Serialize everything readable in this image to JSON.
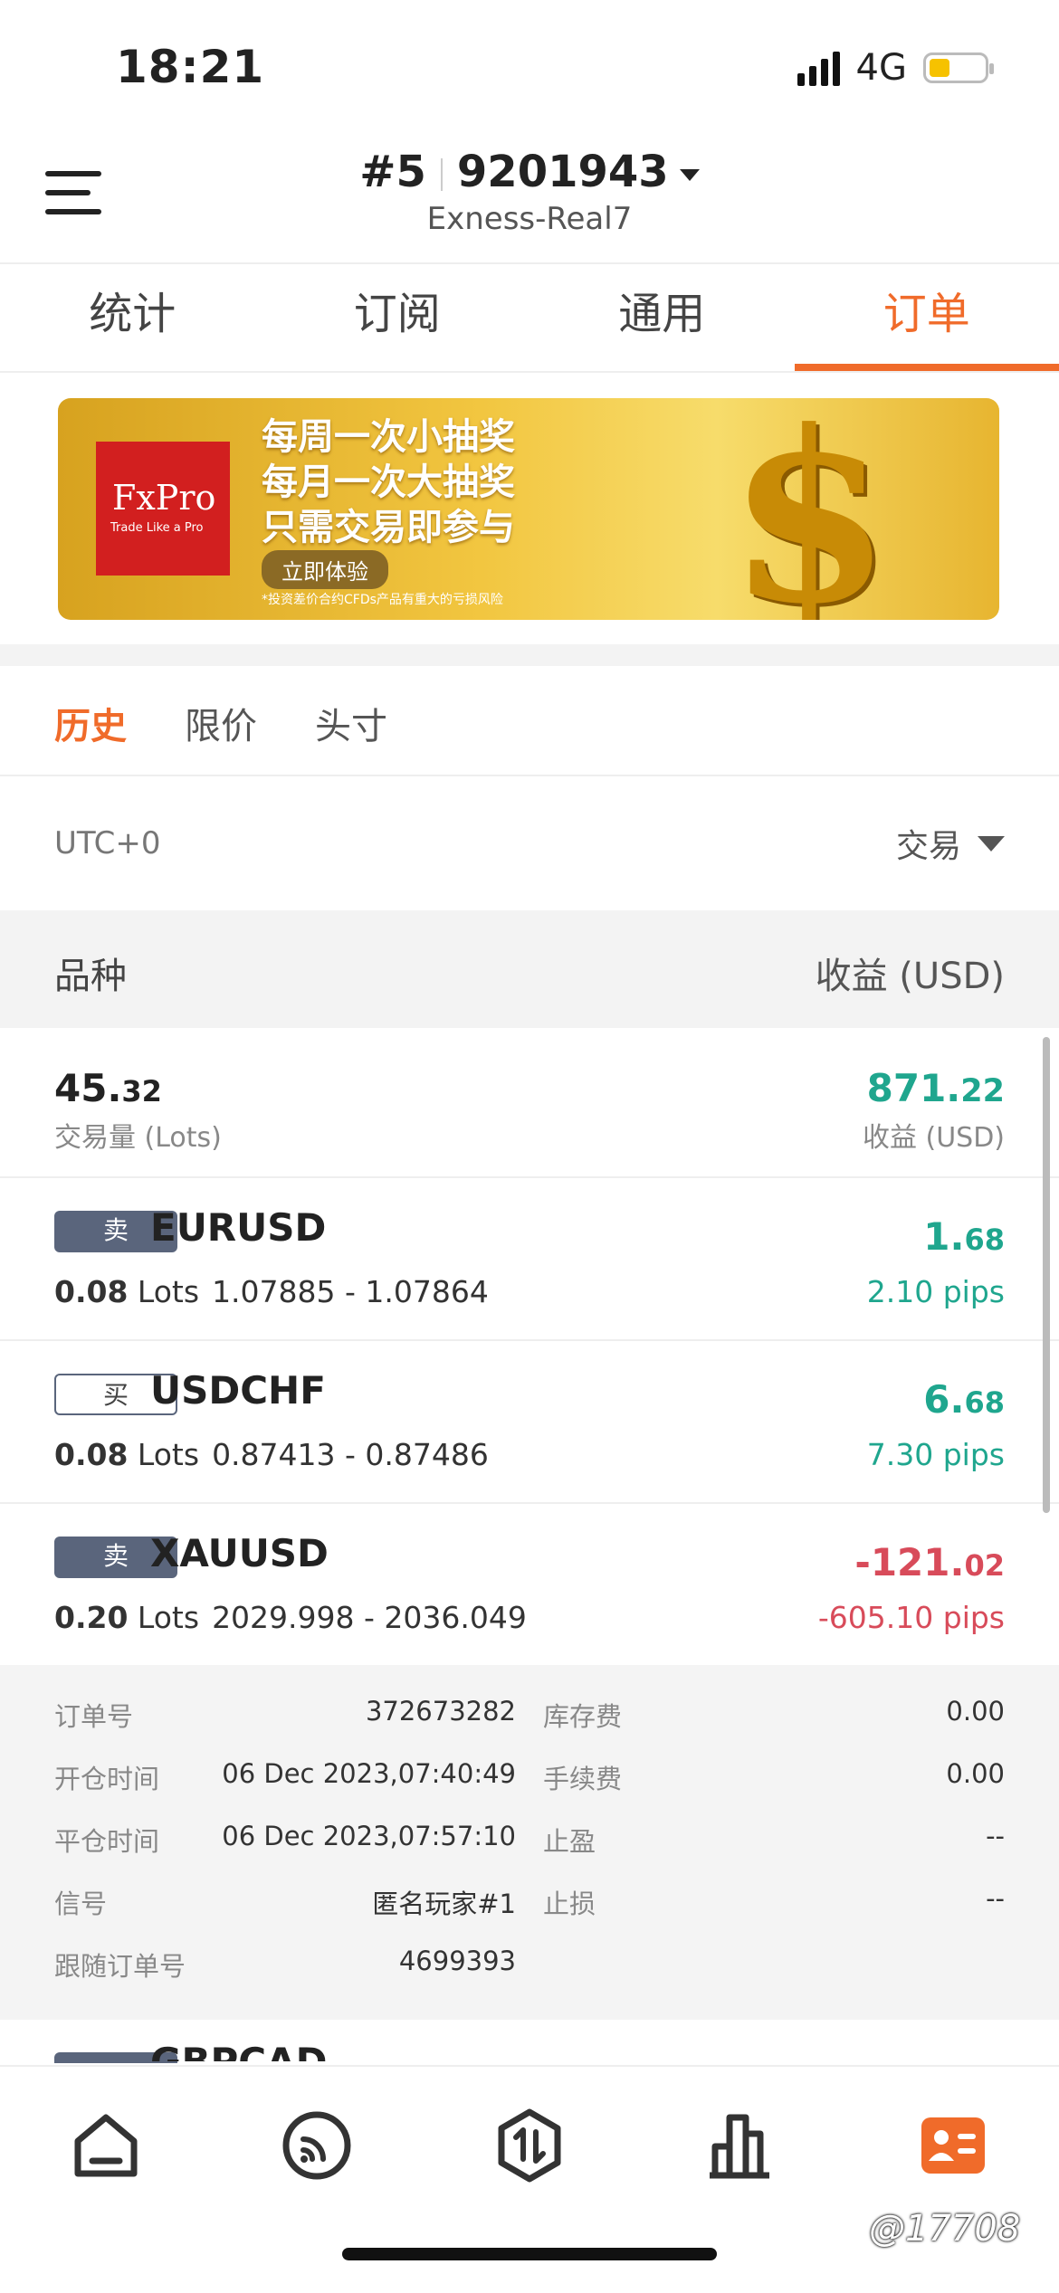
{
  "status": {
    "time": "18:21",
    "network": "4G"
  },
  "header": {
    "account_no": "#5",
    "account_id": "9201943",
    "server": "Exness-Real7"
  },
  "tabs": [
    {
      "label": "统计"
    },
    {
      "label": "订阅"
    },
    {
      "label": "通用"
    },
    {
      "label": "订单",
      "active": true
    }
  ],
  "banner": {
    "brand": "FxPro",
    "tagline": "Trade Like a Pro",
    "lines": [
      "每周一次小抽奖",
      "每月一次大抽奖",
      "只需交易即参与"
    ],
    "cta": "立即体验",
    "disclaimer": "*投资差价合约CFDs产品有重大的亏损风险"
  },
  "subtabs": [
    {
      "label": "历史",
      "active": true
    },
    {
      "label": "限价"
    },
    {
      "label": "头寸"
    }
  ],
  "timezone": "UTC+0",
  "filter": "交易",
  "columns": {
    "symbol": "品种",
    "profit": "收益 (USD)"
  },
  "summary": {
    "volume_int": "45.",
    "volume_dec": "32",
    "volume_label": "交易量 (Lots)",
    "profit_int": "871.",
    "profit_dec": "22",
    "profit_label": "收益 (USD)"
  },
  "orders": [
    {
      "side": "卖",
      "symbol": "EURUSD",
      "lots": "0.08",
      "lots_unit": "Lots",
      "prices": "1.07885 - 1.07864",
      "profit_int": "1.",
      "profit_dec": "68",
      "pips": "2.10 pips",
      "status": "profit"
    },
    {
      "side": "买",
      "symbol": "USDCHF",
      "lots": "0.08",
      "lots_unit": "Lots",
      "prices": "0.87413 - 0.87486",
      "profit_int": "6.",
      "profit_dec": "68",
      "pips": "7.30 pips",
      "status": "profit"
    },
    {
      "side": "卖",
      "symbol": "XAUUSD",
      "lots": "0.20",
      "lots_unit": "Lots",
      "prices": "2029.998 - 2036.049",
      "profit_int": "-121.",
      "profit_dec": "02",
      "pips": "-605.10 pips",
      "status": "loss"
    }
  ],
  "details": {
    "order_no_label": "订单号",
    "order_no": "372673282",
    "open_time_label": "开仓时间",
    "open_time": "06 Dec 2023,07:40:49",
    "close_time_label": "平仓时间",
    "close_time": "06 Dec 2023,07:57:10",
    "signal_label": "信号",
    "signal": "匿名玩家#1",
    "follow_label": "跟随订单号",
    "follow": "4699393",
    "swap_label": "库存费",
    "swap": "0.00",
    "fee_label": "手续费",
    "fee": "0.00",
    "tp_label": "止盈",
    "tp": "--",
    "sl_label": "止损",
    "sl": "--"
  },
  "next_order_symbol": "GBPCAD",
  "nav_icons": [
    "home-icon",
    "signal-feed-icon",
    "trade-icon",
    "chart-icon",
    "profile-card-icon"
  ],
  "watermark": "@17708",
  "colors": {
    "accent": "#f06b2a",
    "profit": "#1fa68e",
    "loss": "#d84b5a",
    "badge": "#5a657c"
  }
}
